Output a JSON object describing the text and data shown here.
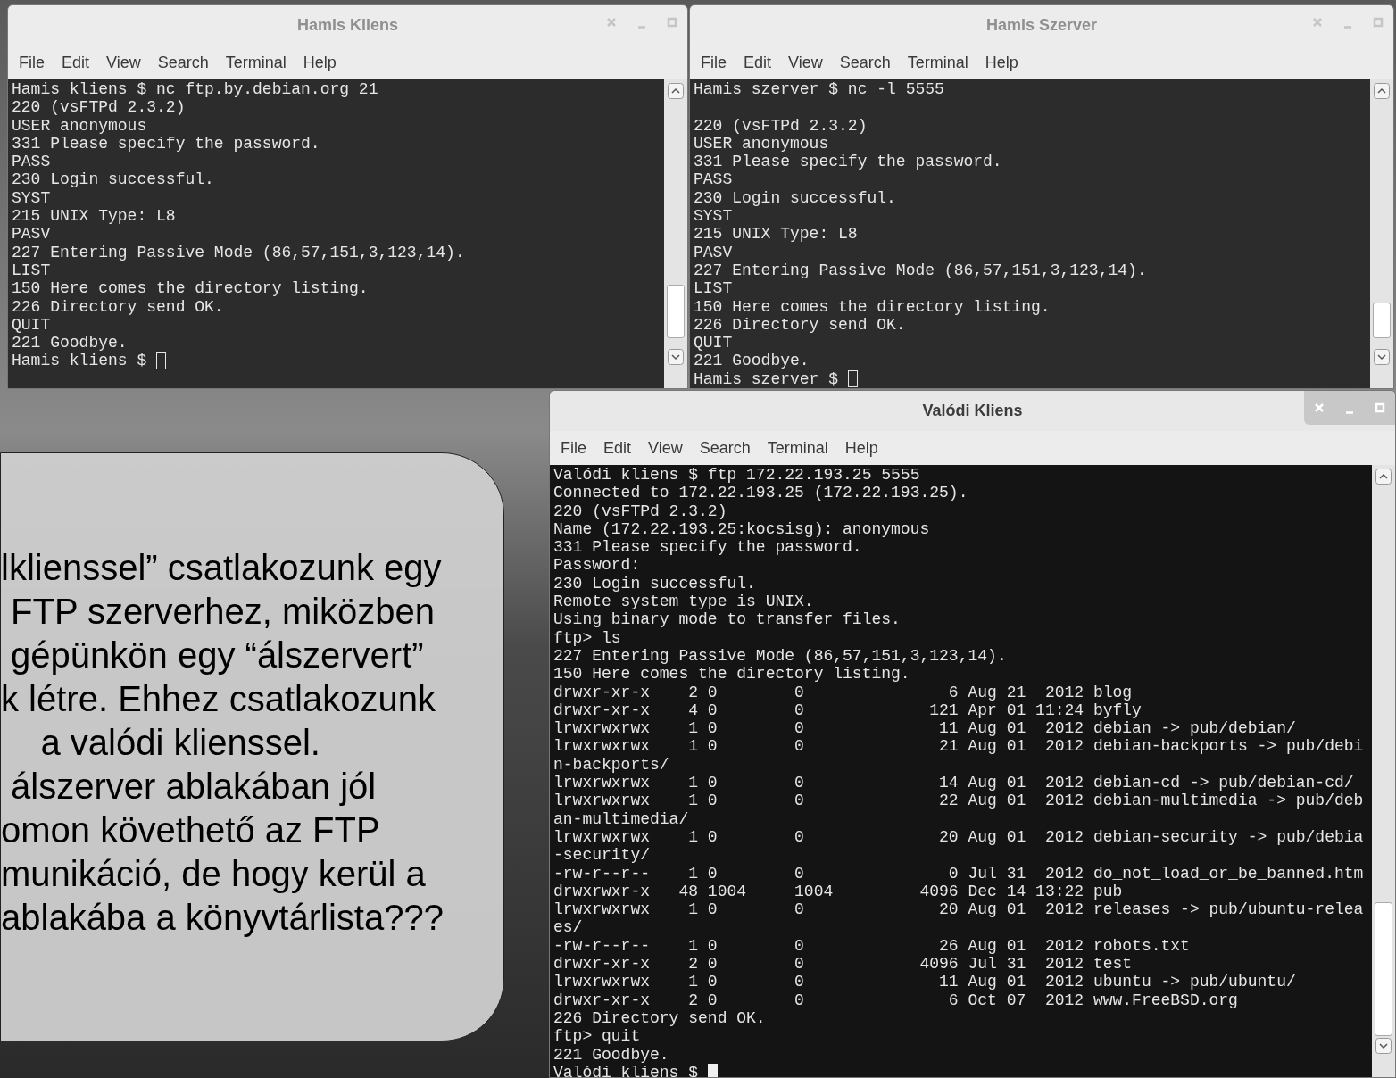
{
  "windows": [
    {
      "title": "Hamis Kliens",
      "focused": false,
      "menu": [
        "File",
        "Edit",
        "View",
        "Search",
        "Terminal",
        "Help"
      ],
      "cursor_filled": false,
      "lines": [
        {
          "text": "Hamis kliens $ nc ftp.by.debian.org 21"
        },
        {
          "text": "220 (vsFTPd 2.3.2)"
        },
        {
          "text": "USER anonymous"
        },
        {
          "text": "331 Please specify the password."
        },
        {
          "text": "PASS"
        },
        {
          "text": "230 Login successful."
        },
        {
          "text": "SYST"
        },
        {
          "text": "215 UNIX Type: L8"
        },
        {
          "text": "PASV"
        },
        {
          "text": "227 Entering Passive Mode (86,57,151,3,123,14)."
        },
        {
          "text": "LIST"
        },
        {
          "text": "150 Here comes the directory listing."
        },
        {
          "text": "226 Directory send OK."
        },
        {
          "text": "QUIT"
        },
        {
          "text": "221 Goodbye."
        },
        {
          "text": "Hamis kliens $ "
        }
      ]
    },
    {
      "title": "Hamis Szerver",
      "focused": false,
      "menu": [
        "File",
        "Edit",
        "View",
        "Search",
        "Terminal",
        "Help"
      ],
      "cursor_filled": false,
      "lines": [
        {
          "text": "Hamis szerver $ nc -l 5555"
        },
        {
          "text": "220 (vsFTPd 2.3.2)",
          "gap_before": true
        },
        {
          "text": "USER anonymous"
        },
        {
          "text": "331 Please specify the password."
        },
        {
          "text": "PASS"
        },
        {
          "text": "230 Login successful."
        },
        {
          "text": "SYST"
        },
        {
          "text": "215 UNIX Type: L8"
        },
        {
          "text": "PASV"
        },
        {
          "text": "227 Entering Passive Mode (86,57,151,3,123,14)."
        },
        {
          "text": "LIST"
        },
        {
          "text": "150 Here comes the directory listing."
        },
        {
          "text": "226 Directory send OK."
        },
        {
          "text": "QUIT"
        },
        {
          "text": "221 Goodbye."
        },
        {
          "text": "Hamis szerver $ "
        }
      ]
    },
    {
      "title": "Valódi Kliens",
      "focused": true,
      "menu": [
        "File",
        "Edit",
        "View",
        "Search",
        "Terminal",
        "Help"
      ],
      "cursor_filled": true,
      "lines": [
        {
          "text": "Valódi kliens $ ftp 172.22.193.25 5555"
        },
        {
          "text": "Connected to 172.22.193.25 (172.22.193.25)."
        },
        {
          "text": "220 (vsFTPd 2.3.2)"
        },
        {
          "text": "Name (172.22.193.25:kocsisg): anonymous"
        },
        {
          "text": "331 Please specify the password."
        },
        {
          "text": "Password:"
        },
        {
          "text": "230 Login successful."
        },
        {
          "text": "Remote system type is UNIX."
        },
        {
          "text": "Using binary mode to transfer files."
        },
        {
          "text": "ftp> ls"
        },
        {
          "text": "227 Entering Passive Mode (86,57,151,3,123,14)."
        },
        {
          "text": "150 Here comes the directory listing."
        },
        {
          "text": "drwxr-xr-x    2 0        0               6 Aug 21  2012 blog"
        },
        {
          "text": "drwxr-xr-x    4 0        0             121 Apr 01 11:24 byfly"
        },
        {
          "text": "lrwxrwxrwx    1 0        0              11 Aug 01  2012 debian -> pub/debian/"
        },
        {
          "text": "lrwxrwxrwx    1 0        0              21 Aug 01  2012 debian-backports -> pub/debi"
        },
        {
          "text": "n-backports/"
        },
        {
          "text": "lrwxrwxrwx    1 0        0              14 Aug 01  2012 debian-cd -> pub/debian-cd/"
        },
        {
          "text": "lrwxrwxrwx    1 0        0              22 Aug 01  2012 debian-multimedia -> pub/deb"
        },
        {
          "text": "an-multimedia/"
        },
        {
          "text": "lrwxrwxrwx    1 0        0              20 Aug 01  2012 debian-security -> pub/debia"
        },
        {
          "text": "-security/"
        },
        {
          "text": "-rw-r--r--    1 0        0               0 Jul 31  2012 do_not_load_or_be_banned.htm"
        },
        {
          "text": "drwxrwxr-x   48 1004     1004         4096 Dec 14 13:22 pub"
        },
        {
          "text": "lrwxrwxrwx    1 0        0              20 Aug 01  2012 releases -> pub/ubuntu-relea"
        },
        {
          "text": "es/"
        },
        {
          "text": "-rw-r--r--    1 0        0              26 Aug 01  2012 robots.txt"
        },
        {
          "text": "drwxr-xr-x    2 0        0            4096 Jul 31  2012 test"
        },
        {
          "text": "lrwxrwxrwx    1 0        0              11 Aug 01  2012 ubuntu -> pub/ubuntu/"
        },
        {
          "text": "drwxr-xr-x    2 0        0               6 Oct 07  2012 www.FreeBSD.org"
        },
        {
          "text": "226 Directory send OK."
        },
        {
          "text": "ftp> quit"
        },
        {
          "text": "221 Goodbye."
        },
        {
          "text": "Valódi kliens $ "
        }
      ]
    }
  ],
  "callout": {
    "lines": [
      "lklienssel” csatlakozunk egy",
      " FTP szerverhez, miközben",
      " gépünkön egy “álszervert”",
      "k létre. Ehhez csatlakozunk",
      "    a valódi klienssel.",
      " álszerver ablakában jól",
      "omon követhető az FTP",
      "munikáció, de hogy kerül a",
      "ablakába a könyvtárlista???"
    ]
  }
}
